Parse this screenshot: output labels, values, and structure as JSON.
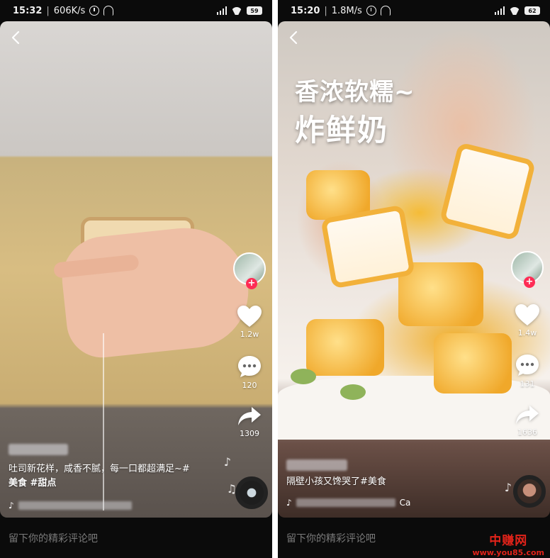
{
  "left": {
    "status": {
      "time": "15:32",
      "speed": "606K/s",
      "battery": "59"
    },
    "caption_line1": "吐司新花样，咸香不腻，每一口都超满足~#",
    "caption_line2": "美食 #甜点",
    "stats": {
      "likes": "1.2w",
      "comments": "120",
      "shares": "1309"
    },
    "comment_placeholder": "留下你的精彩评论吧"
  },
  "right": {
    "status": {
      "time": "15:20",
      "speed": "1.8M/s",
      "battery": "62"
    },
    "overlay_line1": "香浓软糯~",
    "overlay_line2": "炸鲜奶",
    "caption": "隔壁小孩又馋哭了#美食",
    "music_tail": "Ca",
    "stats": {
      "likes": "1.4w",
      "comments": "131",
      "shares": "1636"
    },
    "comment_placeholder": "留下你的精彩评论吧"
  },
  "watermark": {
    "title": "中赚网",
    "url": "www.you85.com"
  },
  "icons": [
    "back-icon",
    "heart-icon",
    "comment-icon",
    "share-icon",
    "music-note-icon",
    "follow-plus-icon",
    "alarm-icon",
    "headset-icon",
    "wifi-icon",
    "signal-icon",
    "battery-icon"
  ],
  "colors": {
    "accent": "#fe2c55",
    "watermark": "#e2231a",
    "background": "#0b0b0b"
  }
}
